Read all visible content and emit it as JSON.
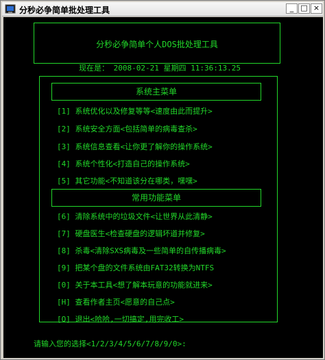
{
  "window": {
    "title": "分秒必争简单批处理工具",
    "minimize": "_",
    "maximize": "□",
    "close": "×"
  },
  "header": {
    "title": "分秒必争简单个人DOS批处理工具"
  },
  "datetime": "现在是：  2008-02-21  星期四  11:36:13.25",
  "main_menu": {
    "title": "系统主菜单",
    "items": [
      "[1]  系统优化以及修复等等<速度由此而提升>",
      "[2]  系统安全方面<包括简单的病毒查杀>",
      "[3]  系统信息查看<让你更了解你的操作系统>",
      "[4]  系统个性化<打造自己的操作系统>",
      "[5]  其它功能<不知道该分在哪类，嘿嘿>"
    ]
  },
  "common_menu": {
    "title": "常用功能菜单",
    "items": [
      "[6]  清除系统中的垃圾文件<让世界从此清静>",
      "[7]  硬盘医生<检查硬盘的逻辑坏道并修复>",
      "[8]  杀毒<清除SXS病毒及一些简单的自传播病毒>",
      "[9]  把某个盘的文件系统由FAT32转换为NTFS",
      "[0]  关于本工具<想了解本玩意的功能就进来>",
      "[H]  查看作者主页<愿意的自己点>",
      "[Q]  退出<哈哈,一切搞定,用完收工>"
    ]
  },
  "prompt": "请输入您的选择<1/2/3/4/5/6/7/8/9/0>:",
  "colors": {
    "text": "#22d92a",
    "background": "#000000"
  }
}
